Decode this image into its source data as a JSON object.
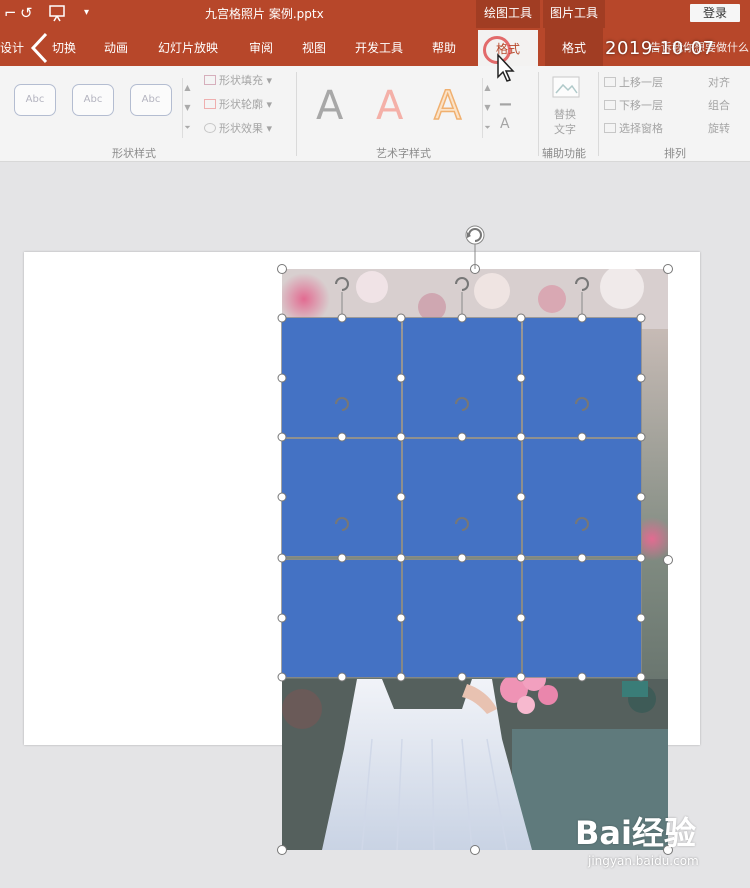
{
  "titlebar": {
    "document_title": "九宫格照片 案例.pptx",
    "context_tab_groups": [
      "绘图工具",
      "图片工具"
    ],
    "login_label": "登录",
    "quick_access_icons": [
      "redo-icon",
      "slideshow-from-start-icon",
      "customize-quick-access-icon"
    ]
  },
  "tabs": [
    "设计",
    "切换",
    "动画",
    "幻灯片放映",
    "审阅",
    "视图",
    "开发工具",
    "帮助"
  ],
  "active_tab": "格式",
  "picture_format_tab": "格式",
  "tell_me_text": "告诉我你想要做什么",
  "overlay_date": "2019-10-07",
  "ribbon": {
    "shape_style_presets": [
      "Abc",
      "Abc",
      "Abc"
    ],
    "shape_fill": "形状填充",
    "shape_outline": "形状轮廓",
    "shape_effects": "形状效果",
    "shape_styles_group": "形状样式",
    "wordart_letter": "A",
    "wordart_group": "艺术字样式",
    "alt_text_line1": "替换",
    "alt_text_line2": "文字",
    "accessibility_group": "辅助功能",
    "bring_forward": "上移一层",
    "send_backward": "下移一层",
    "selection_pane": "选择窗格",
    "align": "对齐",
    "group": "组合",
    "rotate": "旋转",
    "arrange_group": "排列"
  },
  "slide": {
    "grid_rows": 3,
    "grid_cols": 3,
    "tile_color": "#4472c4"
  },
  "colors": {
    "accent": "#b7472a",
    "tile": "#4472c4",
    "slide_bg": "#ffffff",
    "workspace_bg": "#e4e4e6"
  },
  "watermark": {
    "logo_text": "Bai经验",
    "url": "jingyan.baidu.com"
  }
}
